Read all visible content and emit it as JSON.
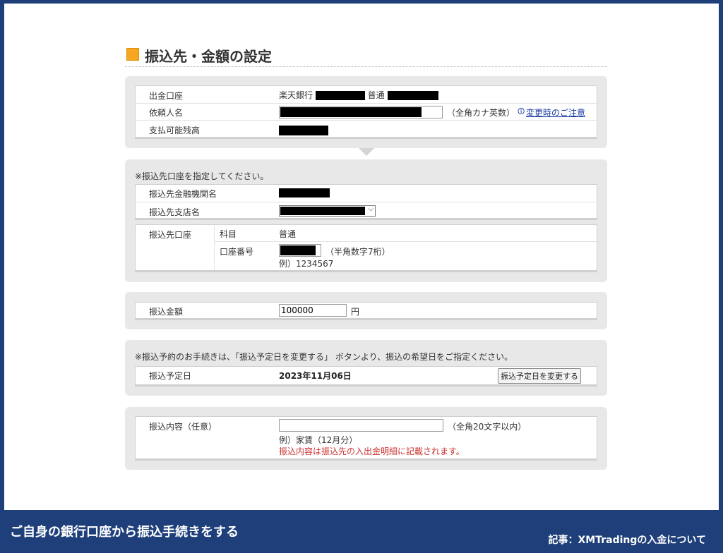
{
  "heading": {
    "title": "振込先・金額の設定"
  },
  "source": {
    "row1_label": "出金口座",
    "bank_name": "楽天銀行",
    "account_type": "普通",
    "row2_label": "依頼人名",
    "requester_hint": "（全角カナ英数）",
    "caution_link": "変更時のご注意",
    "row3_label": "支払可能残高"
  },
  "destination": {
    "note": "※振込先口座を指定してください。",
    "bank_label": "振込先金融機関名",
    "branch_label": "振込先支店名",
    "account_label": "振込先口座",
    "subject_label": "科目",
    "subject_value": "普通",
    "number_label": "口座番号",
    "number_hint": "（半角数字7桁）",
    "number_example": "例）1234567"
  },
  "amount": {
    "label": "振込金額",
    "value": "100000",
    "unit": "円"
  },
  "schedule": {
    "note": "※振込予約のお手続きは、「振込予定日を変更する」 ボタンより、振込の希望日をご指定ください。",
    "label": "振込予定日",
    "date": "2023年11月06日",
    "change_button": "振込予定日を変更する"
  },
  "memo": {
    "label": "振込内容（任意）",
    "value": "",
    "hint": "（全角20文字以内）",
    "example": "例）家賃（12月分）",
    "warning": "振込内容は振込先の入出金明細に記載されます。"
  },
  "banner": {
    "left": "ご自身の銀行口座から振込手続きをする",
    "right": "記事：XMTradingの入金について"
  },
  "colors": {
    "frame_border": "#1e3f7a",
    "heading_square": "#f5a623",
    "panel_bg": "#e8e8e8",
    "link": "#1a3aa0",
    "warning": "#cc3333"
  }
}
